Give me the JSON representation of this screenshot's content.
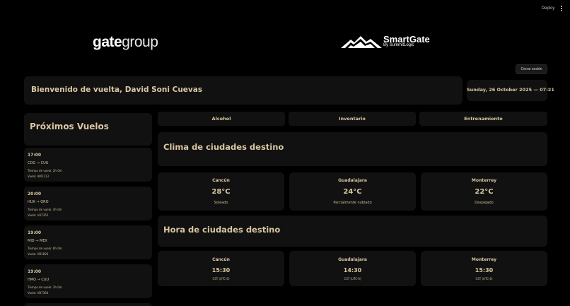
{
  "toolbar": {
    "deploy_label": "Deploy",
    "menu_icon": "kebab-menu-icon"
  },
  "brand": {
    "gate_bold": "gate",
    "gate_light": "group",
    "smartgate_name": "SmartGate",
    "smartgate_tagline": "By SummitLogic"
  },
  "header": {
    "logout_label": "Cerrar sesión",
    "welcome": "Bienvenido de vuelta, David Soni Cuevas",
    "datetime": "Sunday, 26 October 2025 — 07:21"
  },
  "flights": {
    "title": "Próximos Vuelos",
    "items": [
      {
        "time": "17:00",
        "route": "CDG → CUU",
        "duration": "Tiempo de vuelo: 2h 0m",
        "flight": "Vuelo: AM1113"
      },
      {
        "time": "20:00",
        "route": "HUX → QRO",
        "duration": "Tiempo de vuelo: 4h 0m",
        "flight": "Vuelo: UA7351"
      },
      {
        "time": "19:00",
        "route": "MID → MEX",
        "duration": "Tiempo de vuelo: 6h 0m",
        "flight": "Vuelo: VB1826"
      },
      {
        "time": "19:00",
        "route": "HMO → CUU",
        "duration": "Tiempo de vuelo: 3h 0m",
        "flight": "Vuelo: VB7364"
      }
    ]
  },
  "tabs": [
    "Alcohol",
    "Inventario",
    "Entrenamiento"
  ],
  "weather": {
    "title": "Clima de ciudades destino",
    "cities": [
      {
        "city": "Cancún",
        "temp": "28°C",
        "desc": "Soleado"
      },
      {
        "city": "Guadalajara",
        "temp": "24°C",
        "desc": "Parcialmente nublado"
      },
      {
        "city": "Monterrey",
        "temp": "22°C",
        "desc": "Despejado"
      }
    ]
  },
  "clock": {
    "title": "Hora de ciudades destino",
    "cities": [
      {
        "city": "Cancún",
        "time": "15:30",
        "tz": "CST (UTC-6)"
      },
      {
        "city": "Guadalajara",
        "time": "14:30",
        "tz": "CST (UTC-6)"
      },
      {
        "city": "Monterrey",
        "time": "15:30",
        "tz": "CST (UTC-6)"
      }
    ]
  }
}
